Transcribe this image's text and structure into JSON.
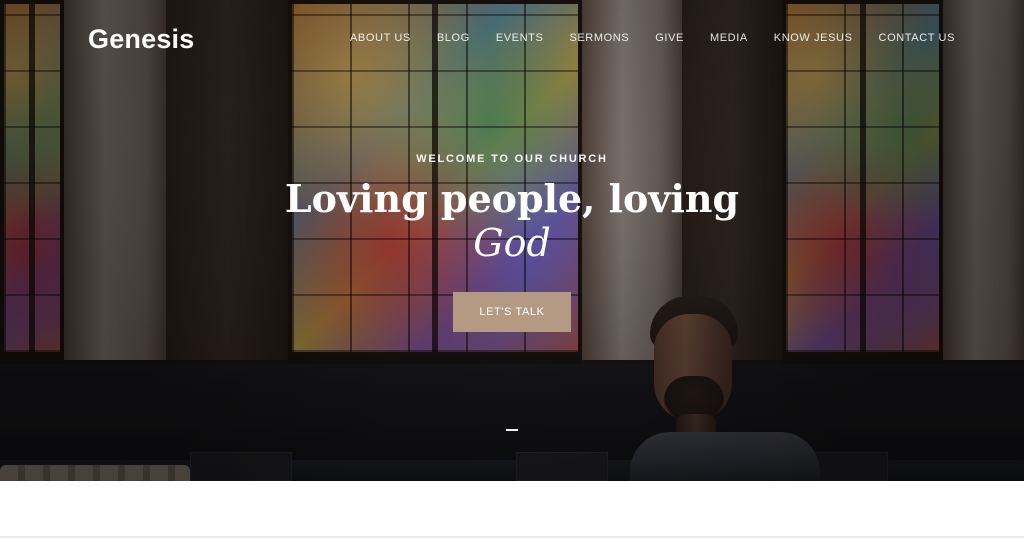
{
  "brand": {
    "logo_text": "Genesis"
  },
  "nav": {
    "items": [
      {
        "label": "ABOUT US"
      },
      {
        "label": "BLOG"
      },
      {
        "label": "EVENTS"
      },
      {
        "label": "SERMONS"
      },
      {
        "label": "GIVE"
      },
      {
        "label": "MEDIA"
      },
      {
        "label": "KNOW JESUS"
      },
      {
        "label": "CONTACT US"
      }
    ]
  },
  "hero": {
    "eyebrow": "WELCOME TO OUR CHURCH",
    "headline_line1": "Loving people, loving",
    "headline_line2": "God",
    "cta_label": "LET'S TALK"
  },
  "colors": {
    "cta_bg": "#b49a82",
    "text_white": "#ffffff"
  }
}
